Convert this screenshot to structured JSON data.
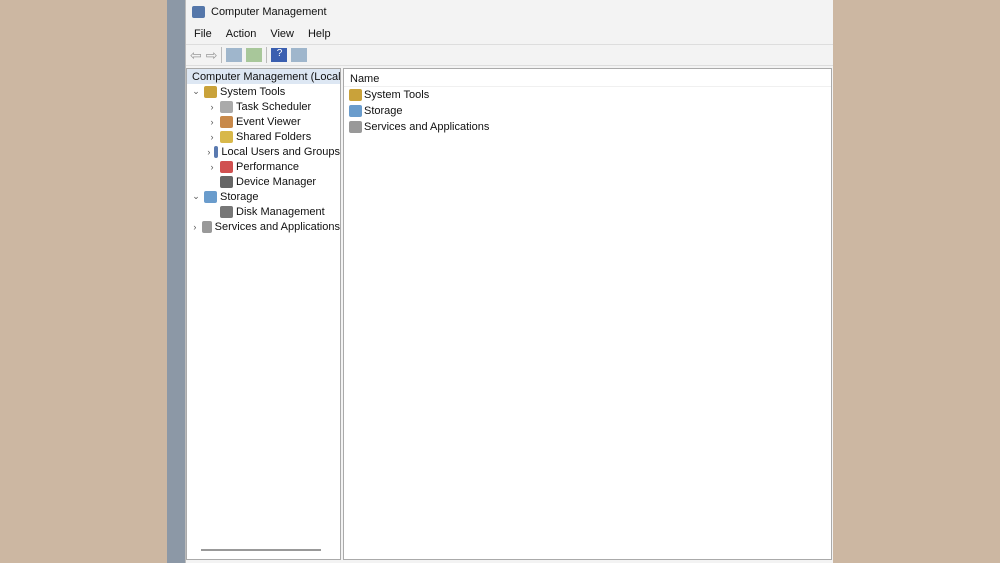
{
  "window": {
    "title": "Computer Management"
  },
  "menu": [
    "File",
    "Action",
    "View",
    "Help"
  ],
  "tree": [
    {
      "label": "Computer Management (Local",
      "level": 0,
      "chev": "",
      "icon": "computer-icon",
      "color": "#5577aa"
    },
    {
      "label": "System Tools",
      "level": 1,
      "chev": "⌄",
      "icon": "tools-icon",
      "color": "#c9a23a"
    },
    {
      "label": "Task Scheduler",
      "level": 2,
      "chev": "›",
      "icon": "clock-icon",
      "color": "#aaa"
    },
    {
      "label": "Event Viewer",
      "level": 2,
      "chev": "›",
      "icon": "event-viewer-icon",
      "color": "#c8894a"
    },
    {
      "label": "Shared Folders",
      "level": 2,
      "chev": "›",
      "icon": "shared-folder-icon",
      "color": "#d8b84a"
    },
    {
      "label": "Local Users and Groups",
      "level": 2,
      "chev": "›",
      "icon": "users-icon",
      "color": "#5a7ab0"
    },
    {
      "label": "Performance",
      "level": 2,
      "chev": "›",
      "icon": "performance-icon",
      "color": "#d05050"
    },
    {
      "label": "Device Manager",
      "level": 2,
      "chev": "",
      "icon": "device-manager-icon",
      "color": "#666"
    },
    {
      "label": "Storage",
      "level": 1,
      "chev": "⌄",
      "icon": "storage-icon",
      "color": "#6a9ccc"
    },
    {
      "label": "Disk Management",
      "level": 2,
      "chev": "",
      "icon": "disk-icon",
      "color": "#777"
    },
    {
      "label": "Services and Applications",
      "level": 1,
      "chev": "›",
      "icon": "services-icon",
      "color": "#999"
    }
  ],
  "list": {
    "header": "Name",
    "items": [
      {
        "label": "System Tools",
        "icon": "tools-icon",
        "color": "#c9a23a"
      },
      {
        "label": "Storage",
        "icon": "storage-icon",
        "color": "#6a9ccc"
      },
      {
        "label": "Services and Applications",
        "icon": "services-icon",
        "color": "#999"
      }
    ]
  }
}
